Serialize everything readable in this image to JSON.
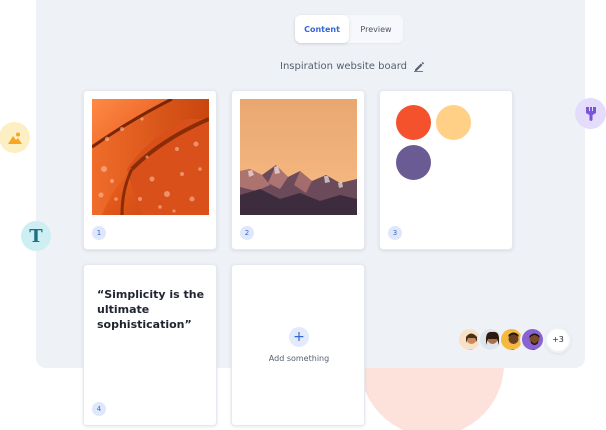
{
  "tabs": [
    {
      "label": "Content",
      "active": true
    },
    {
      "label": "Preview",
      "active": false
    }
  ],
  "board": {
    "title": "Inspiration website board"
  },
  "cards": [
    {
      "number": "1",
      "kind": "image",
      "image": "orange-water-drops-photo"
    },
    {
      "number": "2",
      "kind": "image",
      "image": "mountain-sunset-photo"
    },
    {
      "number": "3",
      "kind": "palette",
      "colors": [
        "#f4522d",
        "#ffd085",
        "#6b5b95"
      ]
    },
    {
      "number": "4",
      "kind": "quote",
      "text": "“Simplicity is the ultimate sophistication”"
    }
  ],
  "add_card": {
    "label": "Add something",
    "icon": "plus-icon"
  },
  "collaborators": {
    "more_label": "+3"
  },
  "floating_icons": [
    "image-icon",
    "text-icon",
    "brush-icon"
  ],
  "colors": {
    "accent": "#3466d6",
    "panel": "#eef1f6",
    "blob": "#fde2dc"
  }
}
